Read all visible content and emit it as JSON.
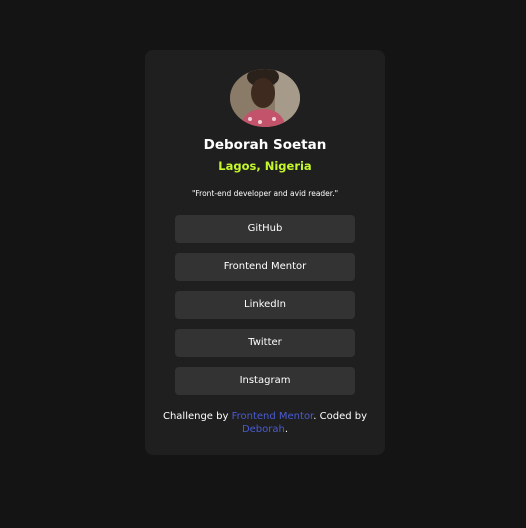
{
  "profile": {
    "name": "Deborah Soetan",
    "location": "Lagos, Nigeria",
    "bio": "\"Front-end developer and avid reader.\""
  },
  "links": [
    {
      "label": "GitHub"
    },
    {
      "label": "Frontend Mentor"
    },
    {
      "label": "LinkedIn"
    },
    {
      "label": "Twitter"
    },
    {
      "label": "Instagram"
    }
  ],
  "footer": {
    "prefix": "Challenge by ",
    "challenge_link": "Frontend Mentor",
    "middle": ". Coded by ",
    "author_link": "Deborah",
    "suffix": "."
  },
  "colors": {
    "background": "#141414",
    "card": "#1f1f1f",
    "button": "#333333",
    "accent": "#c4f82a",
    "link": "#4a5bd1"
  }
}
